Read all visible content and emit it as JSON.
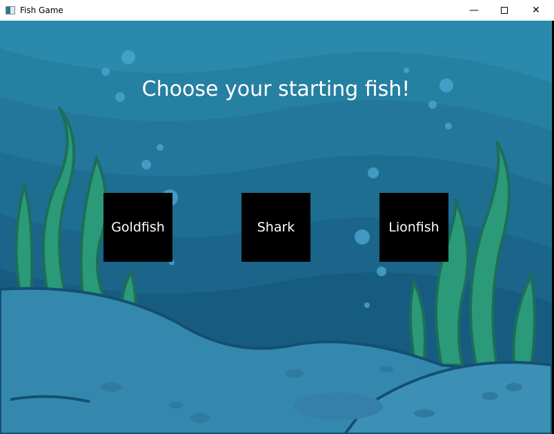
{
  "window": {
    "title": "Fish Game",
    "minimize_icon": "minimize-icon",
    "maximize_icon": "maximize-icon",
    "close_icon": "close-icon"
  },
  "game": {
    "heading": "Choose your starting fish!",
    "options": [
      {
        "label": "Goldfish"
      },
      {
        "label": "Shark"
      },
      {
        "label": "Lionfish"
      }
    ]
  },
  "colors": {
    "water_top": "#2b8aab",
    "water_deep": "#155a80",
    "sand": "#3d90b5",
    "seaweed": "#2a9a78"
  }
}
